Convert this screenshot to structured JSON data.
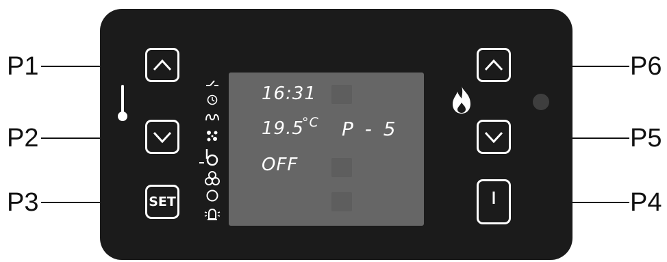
{
  "labels": {
    "p1": "P1",
    "p2": "P2",
    "p3": "P3",
    "p4": "P4",
    "p5": "P5",
    "p6": "P6"
  },
  "buttons": {
    "set_label": "SET"
  },
  "display": {
    "time": "16:31",
    "temperature": "19.5",
    "temperature_unit": "°C",
    "program": "P - 5",
    "status": "OFF"
  },
  "colors": {
    "panel": "#1b1b1b",
    "screen": "#666666",
    "indicator_led": "#3e3e3e"
  },
  "icons": {
    "left_column": [
      "thermometer-icon"
    ],
    "display_side": [
      "switch-icon",
      "clock-icon",
      "heater-coil-icon",
      "fan-speed-icon",
      "water-tap-icon",
      "fan-icon",
      "circle-icon",
      "alarm-bell-icon"
    ],
    "right_column": [
      "flame-icon"
    ]
  }
}
